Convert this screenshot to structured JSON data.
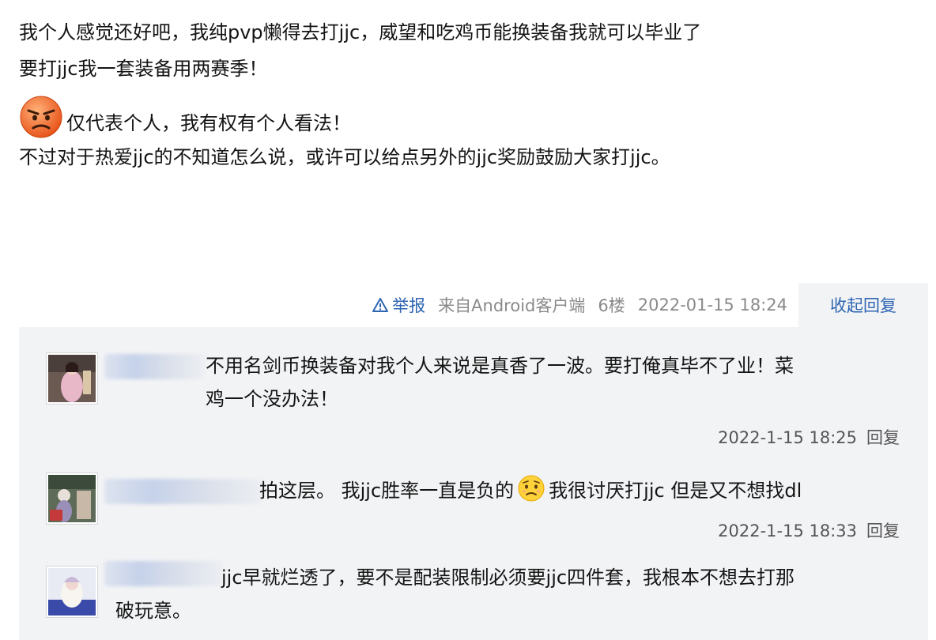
{
  "post": {
    "line1": "我个人感觉还好吧，我纯pvp懒得去打jjc，威望和吃鸡币能换装备我就可以毕业了",
    "line2": "要打jjc我一套装备用两赛季！",
    "line3": "仅代表个人，我有权有个人看法！",
    "line4": "不过对于热爱jjc的不知道怎么说，或许可以给点另外的jjc奖励鼓励大家打jjc。",
    "emoji_icon": "angry-face-icon"
  },
  "meta": {
    "report_label": "举报",
    "source": "来自Android客户端",
    "floor": "6楼",
    "datetime": "2022-01-15 18:24",
    "collapse_label": "收起回复"
  },
  "replies": [
    {
      "text": "不用名剑币换装备对我个人来说是真香了一波。要打俺真毕不了业！菜鸡一个没办法！",
      "line1": "不用名剑币换装备对我个人来说是真香了一波。要打俺真毕不了业！菜",
      "line2": "鸡一个没办法！",
      "time": "2022-1-15 18:25",
      "reply_label": "回复"
    },
    {
      "part1": "拍这层。 我jjc胜率一直是负的",
      "part2": "我很讨厌打jjc 但是又不想找dl",
      "emoji_icon": "worried-face-icon",
      "time": "2022-1-15 18:33",
      "reply_label": "回复"
    },
    {
      "line1": "jjc早就烂透了，要不是配装限制必须要jjc四件套，我根本不想去打那",
      "line2": "破玩意。"
    }
  ],
  "colors": {
    "link": "#2f66b3",
    "reply_bg": "#f2f3f5",
    "meta_text": "#8a8a8a"
  }
}
